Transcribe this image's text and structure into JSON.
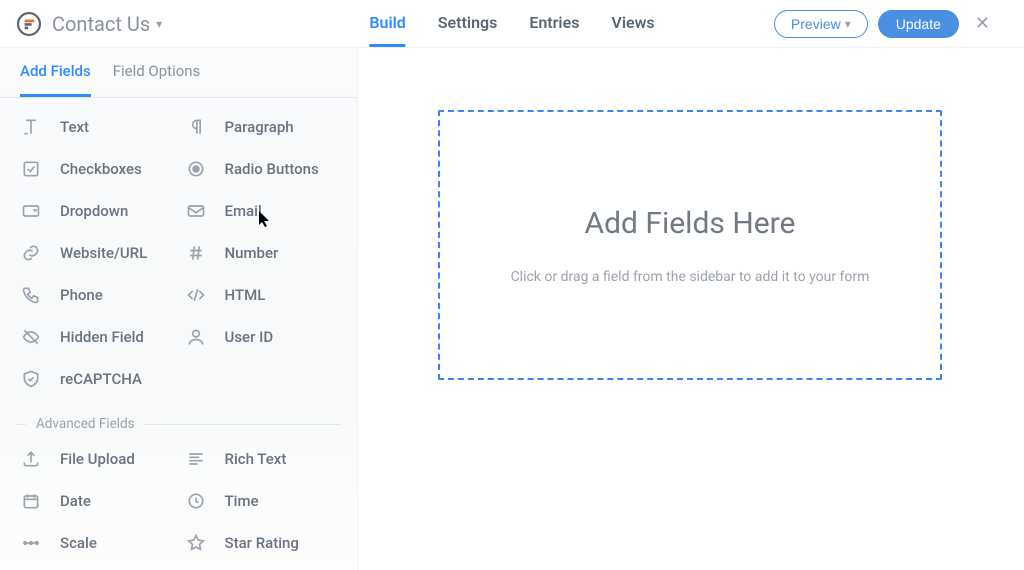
{
  "colors": {
    "accent": "#2f8bff",
    "primaryBtn": "#4a90e2"
  },
  "header": {
    "formTitle": "Contact Us",
    "tabs": [
      "Build",
      "Settings",
      "Entries",
      "Views"
    ],
    "activeTab": 0,
    "previewLabel": "Preview",
    "updateLabel": "Update"
  },
  "sidebar": {
    "tabs": [
      "Add Fields",
      "Field Options"
    ],
    "activeTab": 0,
    "basicFields": [
      {
        "label": "Text",
        "icon": "text"
      },
      {
        "label": "Paragraph",
        "icon": "paragraph"
      },
      {
        "label": "Checkboxes",
        "icon": "checkbox"
      },
      {
        "label": "Radio Buttons",
        "icon": "radio"
      },
      {
        "label": "Dropdown",
        "icon": "dropdown"
      },
      {
        "label": "Email",
        "icon": "email"
      },
      {
        "label": "Website/URL",
        "icon": "link"
      },
      {
        "label": "Number",
        "icon": "hash"
      },
      {
        "label": "Phone",
        "icon": "phone"
      },
      {
        "label": "HTML",
        "icon": "code"
      },
      {
        "label": "Hidden Field",
        "icon": "eye-off"
      },
      {
        "label": "User ID",
        "icon": "user"
      },
      {
        "label": "reCAPTCHA",
        "icon": "shield"
      }
    ],
    "advancedSectionLabel": "Advanced Fields",
    "advancedFields": [
      {
        "label": "File Upload",
        "icon": "upload"
      },
      {
        "label": "Rich Text",
        "icon": "richtext"
      },
      {
        "label": "Date",
        "icon": "calendar"
      },
      {
        "label": "Time",
        "icon": "clock"
      },
      {
        "label": "Scale",
        "icon": "scale"
      },
      {
        "label": "Star Rating",
        "icon": "star"
      }
    ]
  },
  "main": {
    "dropTitle": "Add Fields Here",
    "dropSubtitle": "Click or drag a field from the sidebar to add it to your form"
  }
}
